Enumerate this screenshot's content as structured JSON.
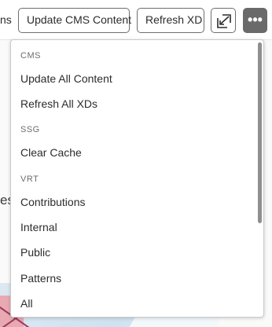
{
  "toolbar": {
    "left_fragment": "ns",
    "update_cms_label": "Update CMS Content",
    "refresh_xd_label": "Refresh XD",
    "more_label": "•••"
  },
  "background": {
    "partial_text": "es"
  },
  "menu": {
    "sections": [
      {
        "heading": "CMS",
        "items": [
          "Update All Content",
          "Refresh All XDs"
        ]
      },
      {
        "heading": "SSG",
        "items": [
          "Clear Cache"
        ]
      },
      {
        "heading": "VRT",
        "items": [
          "Contributions",
          "Internal",
          "Public",
          "Patterns",
          "All"
        ]
      }
    ]
  },
  "colors": {
    "more_button_bg": "#6a6a6a",
    "button_border": "#6e6e6e",
    "menu_section": "#6d6d6d"
  },
  "icons": {
    "open_button": "open-external-icon",
    "more_button": "more-icon"
  }
}
